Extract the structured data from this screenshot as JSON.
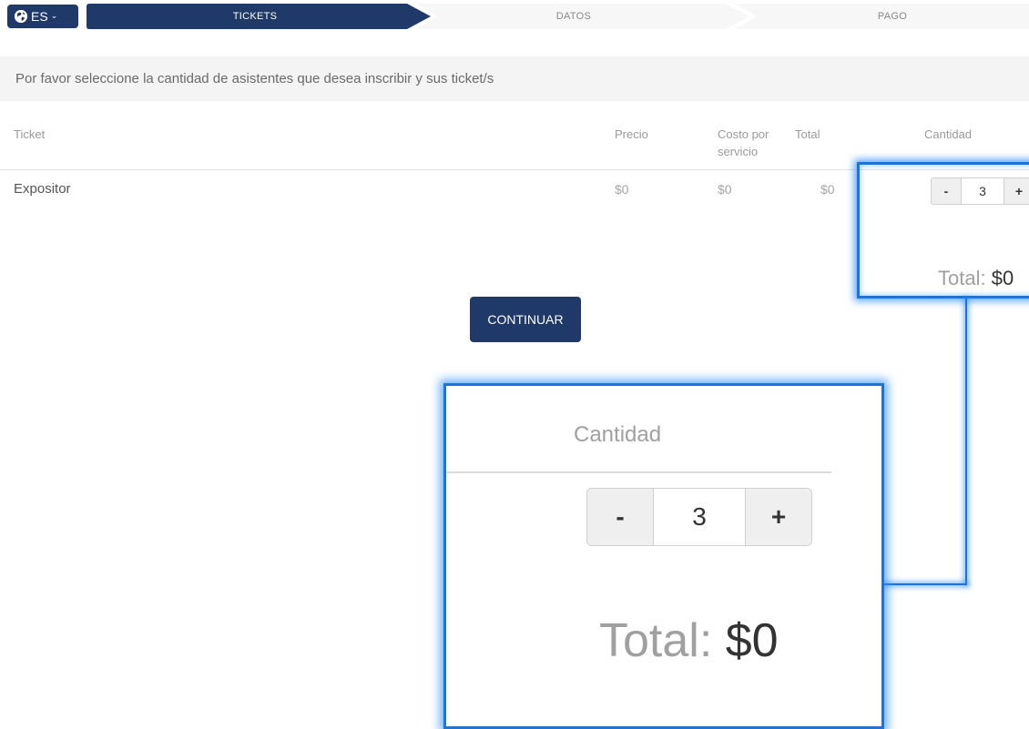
{
  "header": {
    "language": "ES",
    "steps": [
      "TICKETS",
      "DATOS",
      "PAGO"
    ]
  },
  "instruction": "Por favor seleccione la cantidad de asistentes que desea inscribir y sus ticket/s",
  "table": {
    "columns": {
      "ticket": "Ticket",
      "precio": "Precio",
      "costo": "Costo por servicio",
      "total": "Total",
      "cantidad": "Cantidad"
    },
    "rows": [
      {
        "ticket": "Expositor",
        "precio": "$0",
        "costo": "$0",
        "total": "$0",
        "cantidad": "3"
      }
    ]
  },
  "stepper": {
    "minus": "-",
    "plus": "+",
    "value": "3"
  },
  "summary": {
    "total_label": "Total:",
    "total_value": "$0"
  },
  "actions": {
    "continue_label": "CONTINUAR"
  },
  "zoom": {
    "cantidad_label": "Cantidad",
    "stepper_minus": "-",
    "stepper_value": "3",
    "stepper_plus": "+",
    "total_label": "Total:",
    "total_value": "$0"
  },
  "colors": {
    "primary": "#1f3a68",
    "highlight": "#1d74d6",
    "instruction_bg": "#f4f4f4"
  },
  "icons": {
    "language": "globe-icon",
    "language_toggle": "chevron-down-icon"
  }
}
